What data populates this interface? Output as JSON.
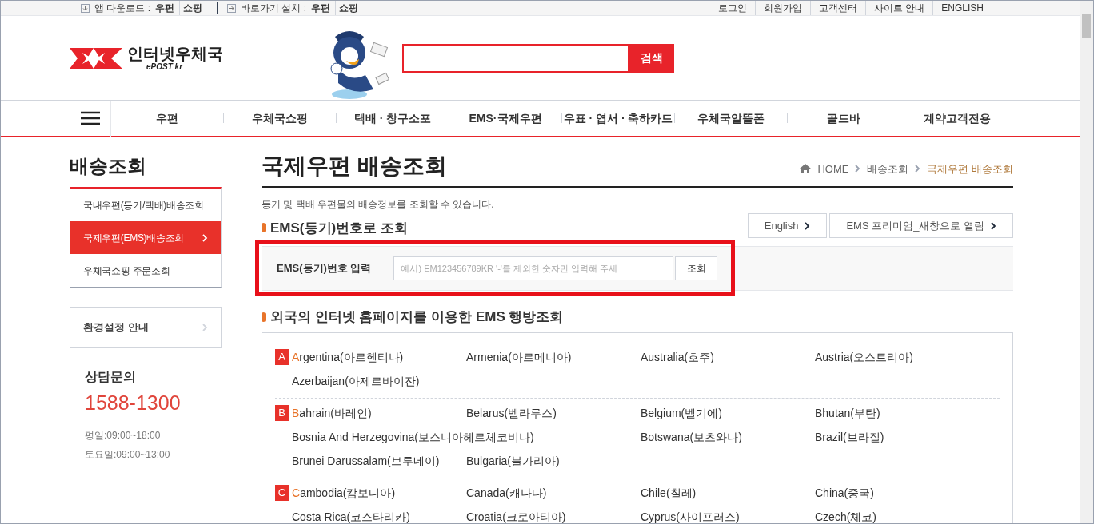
{
  "top_bar": {
    "app_download": {
      "label": "앱 다운로드 :",
      "links": [
        "우편",
        "쇼핑"
      ]
    },
    "shortcut": {
      "label": "바로가기 설치 :",
      "links": [
        "우편",
        "쇼핑"
      ]
    },
    "links": [
      "로그인",
      "회원가입",
      "고객센터",
      "사이트 안내",
      "ENGLISH"
    ]
  },
  "header": {
    "logo": {
      "title": "인터넷우체국",
      "subtitle": "ePOST kr"
    },
    "search": {
      "button": "검색"
    }
  },
  "nav": [
    "우편",
    "우체국쇼핑",
    "택배 · 창구소포",
    "EMS·국제우편",
    "우표 · 엽서 · 축하카드",
    "우체국알뜰폰",
    "골드바",
    "계약고객전용"
  ],
  "sidebar": {
    "title": "배송조회",
    "items": [
      {
        "label": "국내우편(등기/택배)배송조회",
        "selected": false
      },
      {
        "label": "국제우편(EMS)배송조회",
        "selected": true
      },
      {
        "label": "우체국쇼핑 주문조회",
        "selected": false
      }
    ],
    "settings": "환경설정 안내",
    "contact": {
      "title": "상담문의",
      "phone": "1588-1300",
      "hours": [
        "평일:09:00~18:00",
        "토요일:09:00~13:00"
      ]
    }
  },
  "main": {
    "title": "국제우편 배송조회",
    "breadcrumb": [
      "HOME",
      "배송조회",
      "국제우편 배송조회"
    ],
    "description": "등기 및 택배 우편물의 배송정보를 조회할 수 있습니다.",
    "section1": {
      "title": "EMS(등기)번호로 조회",
      "buttons": [
        "English",
        "EMS 프리미엄_새창으로 열림"
      ],
      "field_label": "EMS(등기)번호 입력",
      "placeholder": "예시) EM123456789KR '-'를 제외한 숫자만 입력해 주세",
      "submit": "조회"
    },
    "section2": {
      "title": "외국의 인터넷 홈페이지를 이용한 EMS 행방조회",
      "groups": [
        {
          "letter": "A",
          "countries": [
            "Argentina(아르헨티나)",
            "Armenia(아르메니아)",
            "Australia(호주)",
            "Austria(오스트리아)",
            "Azerbaijan(아제르바이잔)"
          ]
        },
        {
          "letter": "B",
          "countries": [
            "Bahrain(바레인)",
            "Belarus(벨라루스)",
            "Belgium(벨기에)",
            "Bhutan(부탄)",
            "Bosnia And Herzegovina(보스니아헤르체코비나)",
            "Botswana(보츠와나)",
            "Brazil(브라질)",
            "Brunei Darussalam(브루네이)",
            "Bulgaria(불가리아)"
          ]
        },
        {
          "letter": "C",
          "countries": [
            "Cambodia(캄보디아)",
            "Canada(캐나다)",
            "Chile(칠레)",
            "China(중국)",
            "Costa Rica(코스타리카)",
            "Croatia(크로아티아)",
            "Cyprus(사이프러스)",
            "Czech(체코)"
          ]
        }
      ]
    }
  }
}
